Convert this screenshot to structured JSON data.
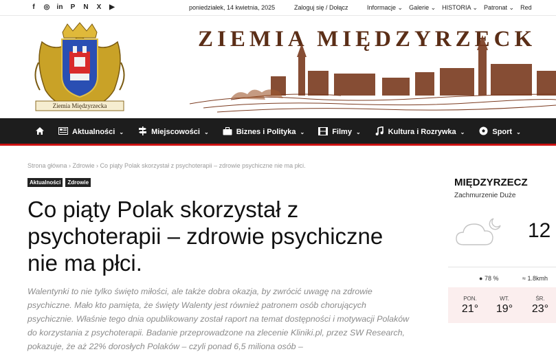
{
  "topbar": {
    "social": [
      "f",
      "◎",
      "in",
      "P",
      "N",
      "X",
      "▶"
    ],
    "date": "poniedziałek, 14 kwietnia, 2025",
    "login": "Zaloguj się / Dołącz",
    "nav": [
      "Informacje ⌄",
      "Galerie ⌄",
      "HISTORIA ⌄",
      "Patronat ⌄",
      "Red"
    ]
  },
  "header": {
    "masthead": "ZIEMIA  MIĘDZYRZECK",
    "logo_banner": "Ziemia Międzyrzecka"
  },
  "navbar": {
    "items": [
      {
        "label": "",
        "icon": "home-icon"
      },
      {
        "label": "Aktualności",
        "icon": "newspaper-icon"
      },
      {
        "label": "Miejscowości",
        "icon": "signpost-icon"
      },
      {
        "label": "Biznes i Polityka",
        "icon": "briefcase-icon"
      },
      {
        "label": "Filmy",
        "icon": "film-icon"
      },
      {
        "label": "Kultura i Rozrywka",
        "icon": "music-icon"
      },
      {
        "label": "Sport",
        "icon": "football-icon"
      }
    ]
  },
  "breadcrumb": "Strona główna  ›  Zdrowie  ›  Co piąty Polak skorzystał z psychoterapii – zdrowie psychiczne nie ma płci.",
  "tags": [
    "Aktualności",
    "Zdrowie"
  ],
  "article": {
    "title": "Co piąty Polak skorzystał z psychoterapii – zdrowie psychiczne nie ma płci.",
    "lead": "Walentynki to nie tylko święto miłości, ale także dobra okazja, by zwrócić uwagę na zdrowie psychiczne. Mało kto pamięta, że święty Walenty jest również patronem osób chorujących psychicznie. Właśnie tego dnia opublikowany został raport na temat dostępności i motywacji Polaków do korzystania z psychoterapii. Badanie przeprowadzone na zlecenie Kliniki.pl, przez SW Research, pokazuje, że aż 22% dorosłych Polaków – czyli ponad 6,5 miliona osób –"
  },
  "weather": {
    "city": "MIĘDZYRZECZ",
    "condition": "Zachmurzenie Duże",
    "temp": "12",
    "humidity": "78 %",
    "wind": "1.8kmh",
    "days": [
      {
        "name": "PON.",
        "temp": "21°"
      },
      {
        "name": "WT.",
        "temp": "19°"
      },
      {
        "name": "ŚR.",
        "temp": "23°"
      }
    ]
  }
}
